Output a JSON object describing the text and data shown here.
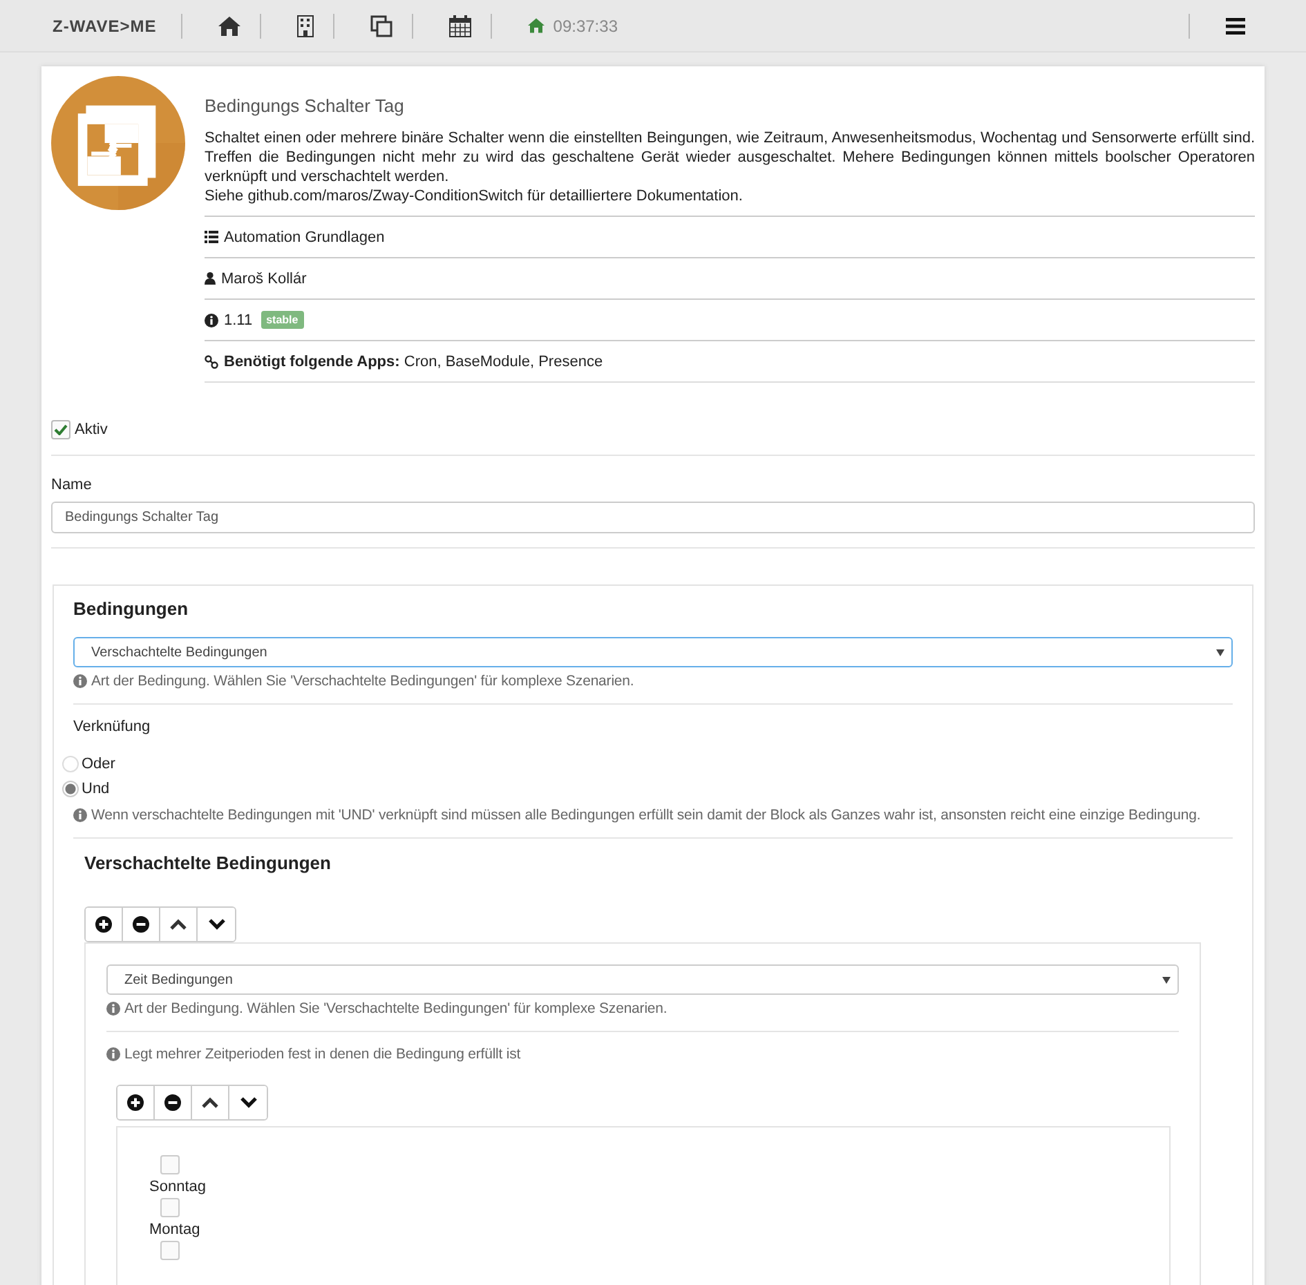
{
  "topbar": {
    "logo": "Z-WAVE>ME",
    "time": "09:37:33"
  },
  "app": {
    "title": "Bedingungs Schalter Tag",
    "description": "Schaltet einen oder mehrere binäre Schalter wenn die einstellten Beingungen, wie Zeitraum, Anwesenheitsmodus, Wochentag und Sensorwerte erfüllt sind. Treffen die Bedingungen nicht mehr zu wird das geschaltene Gerät wieder ausgeschaltet. Mehere Bedingungen können mittels boolscher Operatoren verknüpft und verschachtelt werden.",
    "doc_note": "Siehe github.com/maros/Zway-ConditionSwitch für detailliertere Dokumentation.",
    "category": "Automation Grundlagen",
    "author": "Maroš Kollár",
    "version": "1.11",
    "badge": "stable",
    "dependencies": "**Benötigt folgende Apps:** Cron, BaseModule, Presence"
  },
  "active": {
    "label": "Aktiv",
    "checked": true
  },
  "name_field": {
    "label": "Name",
    "value": "Bedingungs Schalter Tag"
  },
  "conditions": {
    "title": "Bedingungen",
    "type_select": "Verschachtelte Bedingungen",
    "type_help": "Art der Bedingung. Wählen Sie 'Verschachtelte Bedingungen' für komplexe Szenarien.",
    "logic_label": "Verknüfung",
    "logic_options": [
      {
        "label": "Oder",
        "selected": false
      },
      {
        "label": "Und",
        "selected": true
      }
    ],
    "logic_help": "Wenn verschachtelte Bedingungen mit 'UND' verknüpft sind müssen alle Bedingungen erfüllt sein damit der Block als Ganzes wahr ist, ansonsten reicht eine einzige Bedingung.",
    "nested": {
      "title": "Verschachtelte Bedingungen",
      "type_select": "Zeit Bedingungen",
      "type_help": "Art der Bedingung. Wählen Sie 'Verschachtelte Bedingungen' für komplexe Szenarien.",
      "periods_help": "Legt mehrer Zeitperioden fest in denen die Bedingung erfüllt ist",
      "days": [
        {
          "label": "Sonntag",
          "checked": false
        },
        {
          "label": "Montag",
          "checked": false
        },
        {
          "checked": false
        }
      ]
    }
  }
}
